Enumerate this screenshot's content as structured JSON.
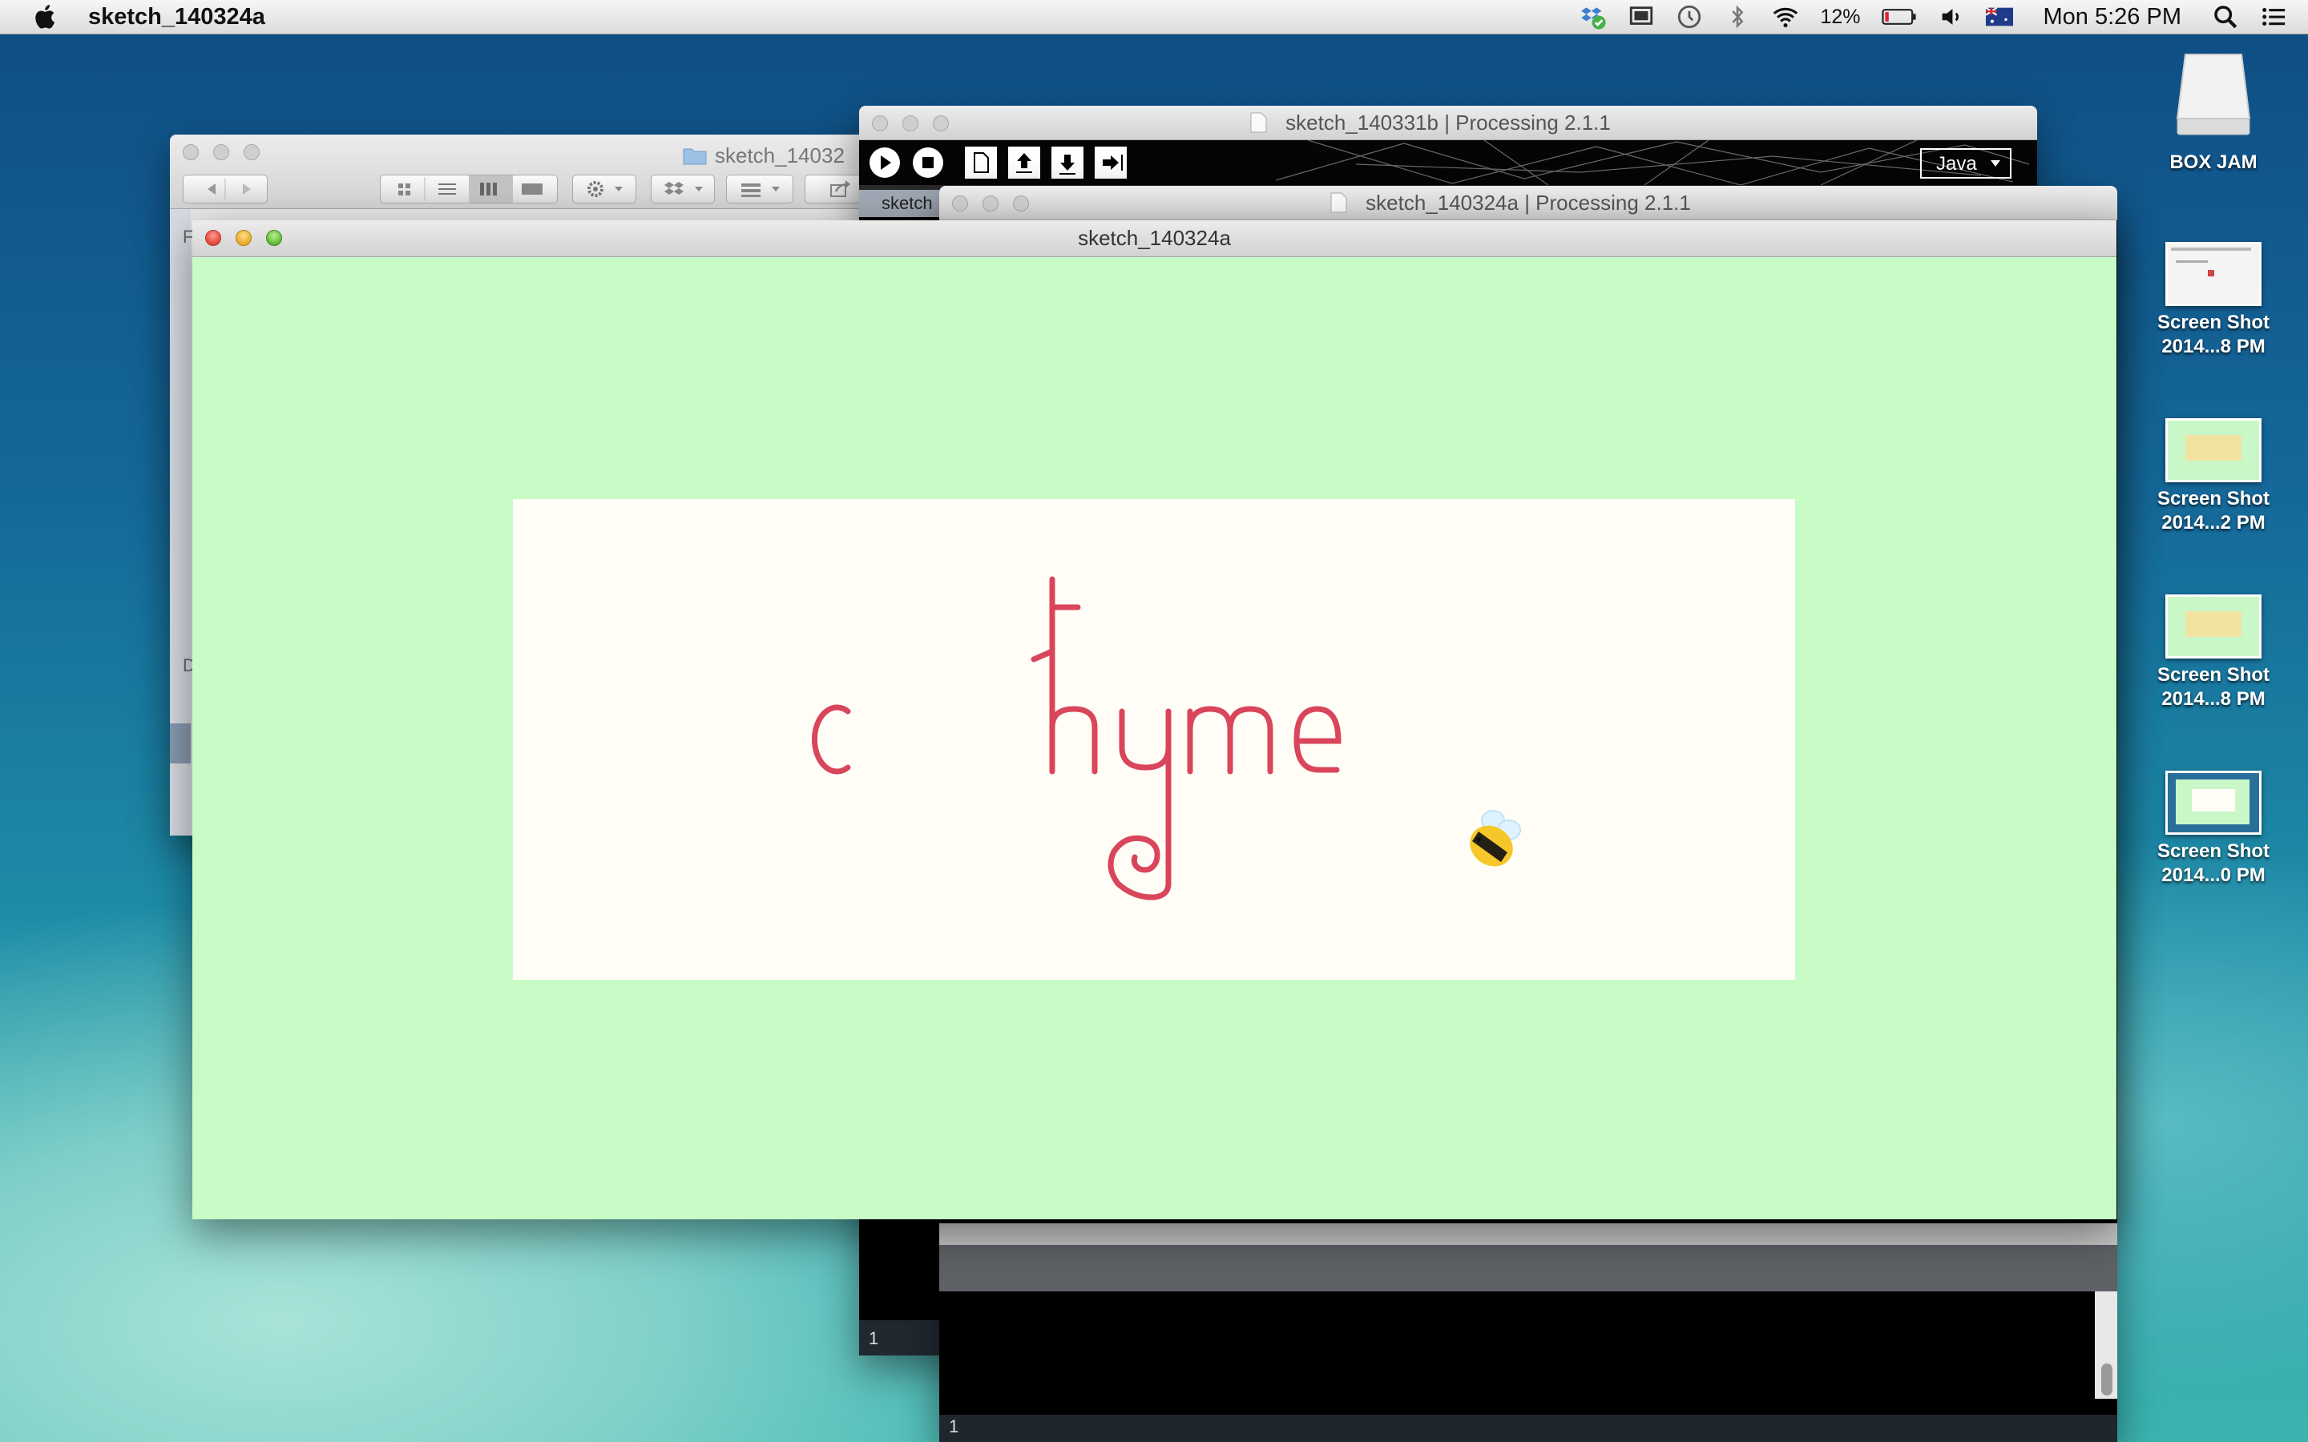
{
  "menubar": {
    "app_name": "sketch_140324a",
    "battery_percent": "12%",
    "clock": "Mon 5:26 PM"
  },
  "finder": {
    "title": "sketch_14032",
    "sidebar_letter_1": "F",
    "sidebar_letter_2": "D"
  },
  "processing_back": {
    "title": "sketch_140331b | Processing 2.1.1",
    "mode": "Java",
    "tab_label": "sketch",
    "line_number": "1"
  },
  "processing_front": {
    "title": "sketch_140324a | Processing 2.1.1",
    "line_number": "1"
  },
  "sketch_window": {
    "title": "sketch_140324a"
  },
  "desktop_icons": [
    {
      "label": "BOX JAM"
    },
    {
      "label": "Screen Shot 2014...8 PM"
    },
    {
      "label": "Screen Shot 2014...2 PM"
    },
    {
      "label": "Screen Shot 2014...8 PM"
    },
    {
      "label": "Screen Shot 2014...0 PM"
    }
  ],
  "colors": {
    "sketch_background": "#c8fbc6",
    "canvas_panel": "#fffdf6",
    "logo_stroke": "#d9455a",
    "bee_yellow": "#f6c72a"
  }
}
